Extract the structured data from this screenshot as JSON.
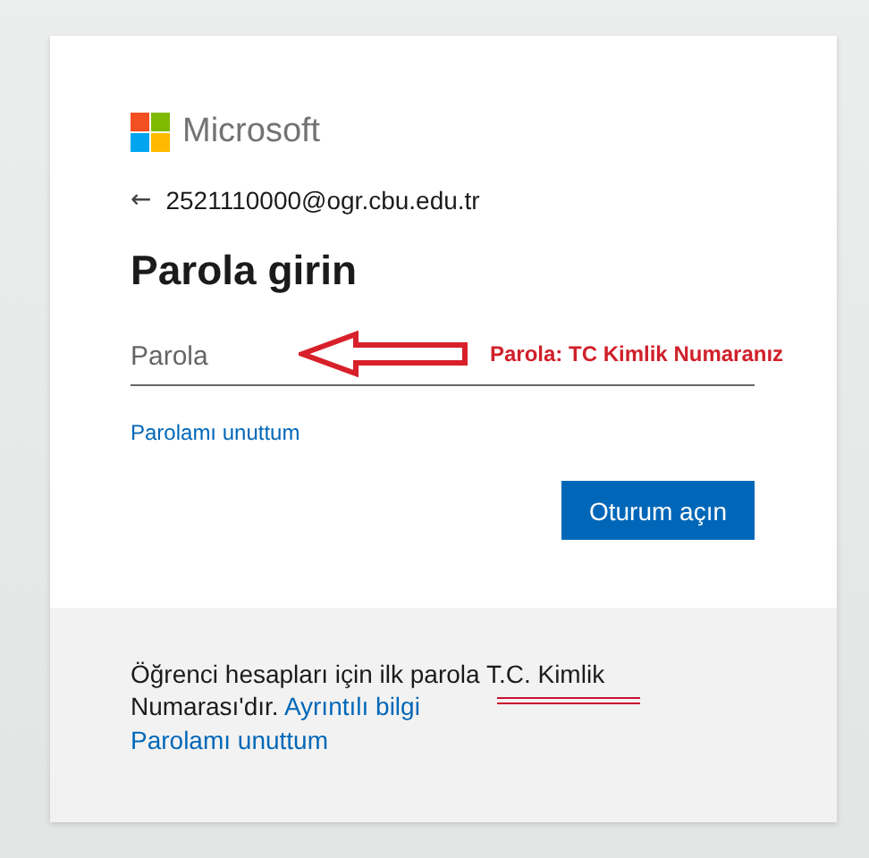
{
  "brand": {
    "name": "Microsoft"
  },
  "account": {
    "back": "←",
    "email": "2521110000@ogr.cbu.edu.tr"
  },
  "title": "Parola girin",
  "password": {
    "placeholder": "Parola"
  },
  "annotation": {
    "text": "Parola: TC Kimlik Numaranız"
  },
  "forgot_link": "Parolamı unuttum",
  "submit_button": "Oturum açın",
  "footer": {
    "text": "Öğrenci hesapları için ilk parola T.C. Kimlik Numarası'dır.",
    "info_link": "Ayrıntılı bilgi",
    "forgot_link": "Parolamı unuttum"
  }
}
